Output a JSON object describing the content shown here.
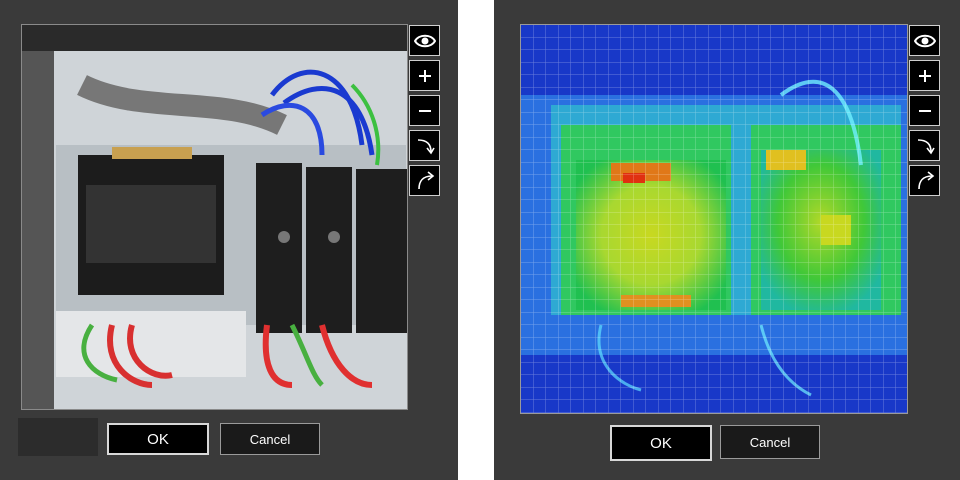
{
  "left_panel": {
    "viewer": {
      "content": "camera-photo-of-electrical-panel"
    },
    "toolbar": [
      "eye-icon",
      "zoom-in-icon",
      "zoom-out-icon",
      "rotate-clockwise-icon",
      "rotate-counterclockwise-icon"
    ],
    "ok_label": "OK",
    "cancel_label": "Cancel"
  },
  "right_panel": {
    "viewer": {
      "content": "thermal-heatmap-overlay"
    },
    "toolbar": [
      "eye-icon",
      "zoom-in-icon",
      "zoom-out-icon",
      "rotate-clockwise-icon",
      "rotate-counterclockwise-icon"
    ],
    "ok_label": "OK",
    "cancel_label": "Cancel"
  },
  "colors": {
    "panel_bg": "#3a3a3a",
    "button_bg": "#000000",
    "heat_cold": "#1030b8",
    "heat_mid": "#20c840",
    "heat_warm": "#d8e020",
    "heat_hot": "#e03010"
  }
}
